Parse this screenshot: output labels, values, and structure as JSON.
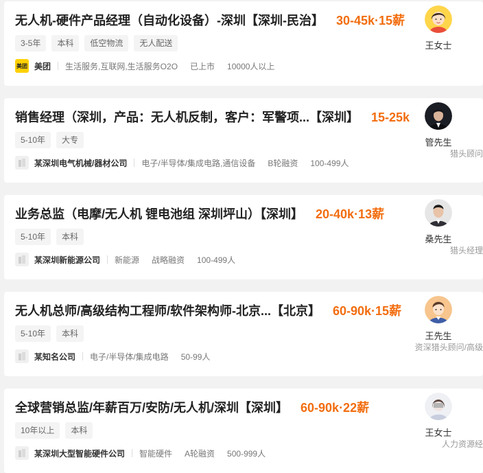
{
  "jobs": [
    {
      "title": "无人机-硬件产品经理（自动化设备）-深圳【深圳-民治】",
      "salary": "30-45k·15薪",
      "tags": [
        "3-5年",
        "本科",
        "低空物流",
        "无人配送"
      ],
      "company": {
        "logo_text": "美团",
        "name": "美团",
        "industry": "生活服务,互联网,生活服务O2O",
        "stage": "已上市",
        "size": "10000人以上"
      },
      "recruiter": {
        "name": "王女士",
        "title": ""
      }
    },
    {
      "title": "销售经理（深圳，产品：无人机反制，客户：军警项...【深圳】",
      "salary": "15-25k",
      "tags": [
        "5-10年",
        "大专"
      ],
      "company": {
        "name": "某深圳电气机械/器材公司",
        "industry": "电子/半导体/集成电路,通信设备",
        "stage": "B轮融资",
        "size": "100-499人"
      },
      "recruiter": {
        "name": "管先生",
        "title": "猎头顾问"
      }
    },
    {
      "title": "业务总监（电摩/无人机 锂电池组 深圳坪山）【深圳】",
      "salary": "20-40k·13薪",
      "tags": [
        "5-10年",
        "本科"
      ],
      "company": {
        "name": "某深圳新能源公司",
        "industry": "新能源",
        "stage": "战略融资",
        "size": "100-499人"
      },
      "recruiter": {
        "name": "桑先生",
        "title": "猎头经理"
      }
    },
    {
      "title": "无人机总师/高级结构工程师/软件架构师-北京...【北京】",
      "salary": "60-90k·15薪",
      "tags": [
        "5-10年",
        "本科"
      ],
      "company": {
        "name": "某知名公司",
        "industry": "电子/半导体/集成电路",
        "stage": "",
        "size": "50-99人"
      },
      "recruiter": {
        "name": "王先生",
        "title": "资深猎头顾问/高级"
      }
    },
    {
      "title": "全球营销总监/年薪百万/安防/无人机/深圳【深圳】",
      "salary": "60-90k·22薪",
      "tags": [
        "10年以上",
        "本科"
      ],
      "company": {
        "name": "某深圳大型智能硬件公司",
        "industry": "智能硬件",
        "stage": "A轮融资",
        "size": "500-999人"
      },
      "recruiter": {
        "name": "王女士",
        "title": "人力资源经"
      }
    }
  ],
  "colors": {
    "salary": "#f26d0e",
    "page_bg": "#f2f2f2",
    "card_bg": "#ffffff",
    "meituan_logo": "#ffd100"
  }
}
